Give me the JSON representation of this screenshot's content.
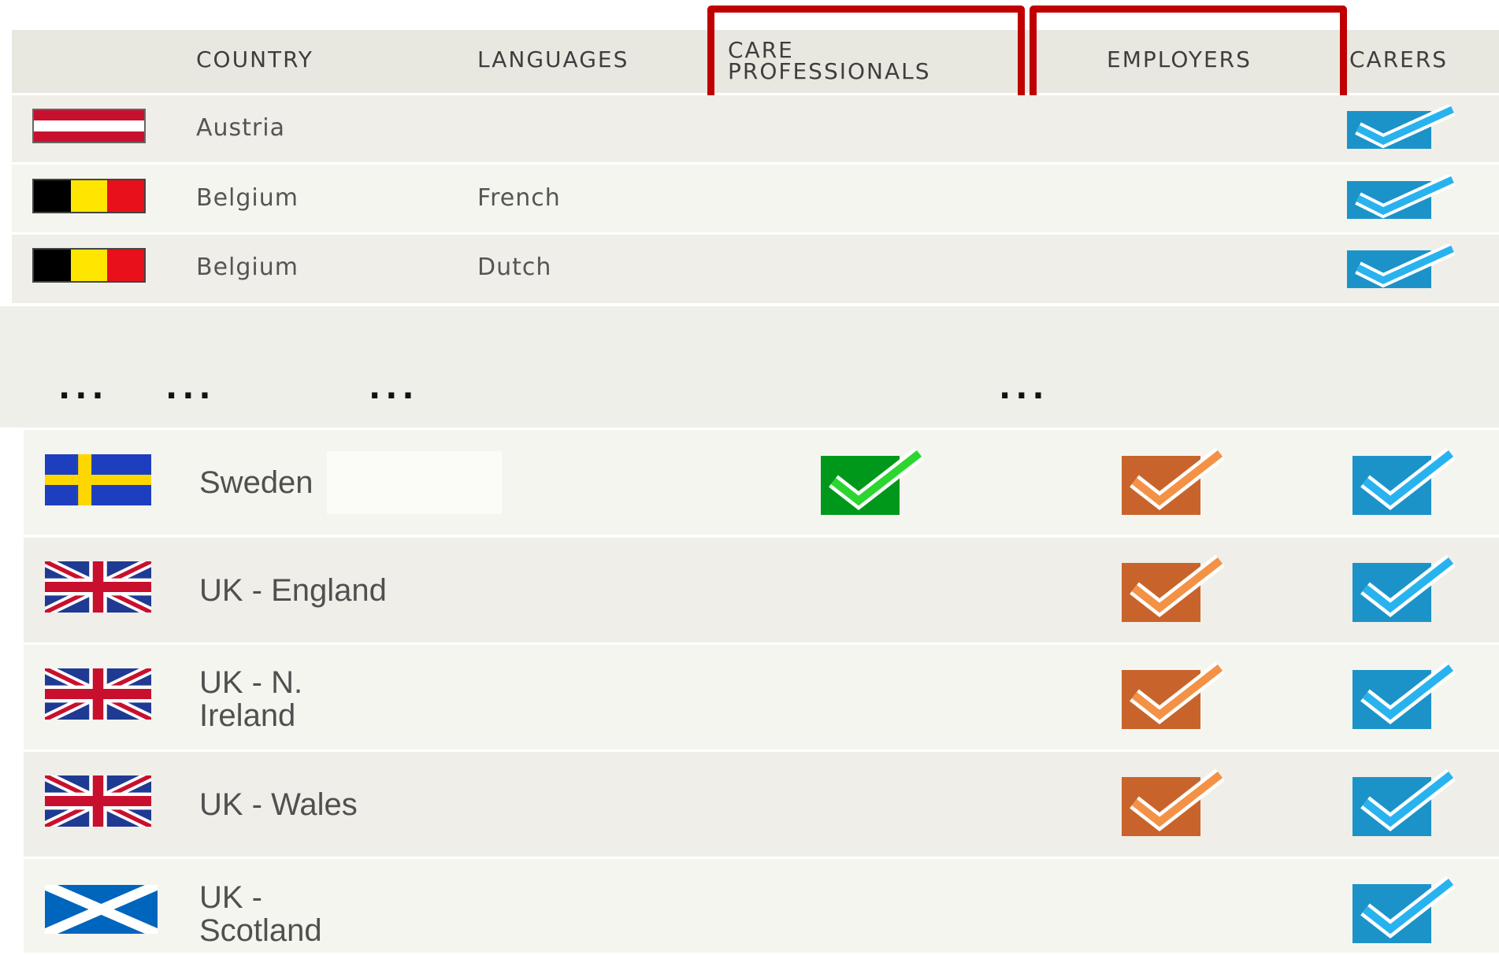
{
  "header": {
    "country": "COUNTRY",
    "languages": "LANGUAGES",
    "care_professionals_line1": "CARE",
    "care_professionals_line2": "PROFESSIONALS",
    "employers": "EMPLOYERS",
    "carers": "CARERS"
  },
  "rows_top": [
    {
      "flag": "austria-flag",
      "country": "Austria",
      "language": "",
      "care_professionals": false,
      "employers": false,
      "carers": true
    },
    {
      "flag": "belgium-flag",
      "country": "Belgium",
      "language": "French",
      "care_professionals": false,
      "employers": false,
      "carers": true
    },
    {
      "flag": "belgium-flag",
      "country": "Belgium",
      "language": "Dutch",
      "care_professionals": false,
      "employers": false,
      "carers": true
    }
  ],
  "ellipsis": {
    "a": "...",
    "b": "...",
    "c": "...",
    "d": "..."
  },
  "rows_bottom": [
    {
      "flag": "sweden-flag",
      "country": "Sweden",
      "care_professionals": true,
      "employers": true,
      "carers": true
    },
    {
      "flag": "uk-flag",
      "country": "UK - England",
      "care_professionals": false,
      "employers": true,
      "carers": true
    },
    {
      "flag": "uk-flag",
      "country_line1": "UK - N.",
      "country_line2": "Ireland",
      "care_professionals": false,
      "employers": true,
      "carers": true
    },
    {
      "flag": "uk-flag",
      "country": "UK - Wales",
      "care_professionals": false,
      "employers": true,
      "carers": true
    },
    {
      "flag": "scotland-flag",
      "country_line1": "UK -",
      "country_line2": "Scotland",
      "care_professionals": false,
      "employers": false,
      "carers": true
    }
  ],
  "colors": {
    "highlight_box": "#c00000",
    "care_professionals_check": "#00a21a",
    "employers_check": "#c8642b",
    "carers_check": "#1c93c8"
  }
}
